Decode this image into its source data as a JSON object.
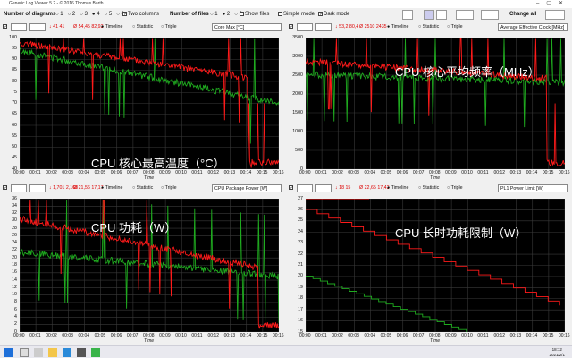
{
  "window": {
    "title": "Generic Log Viewer 5.2 - © 2016 Thomas Barth"
  },
  "toolbar": {
    "num_diagrams_label": "Number of diagrams",
    "diagram_options": [
      "1",
      "2",
      "3",
      "4",
      "5",
      "6"
    ],
    "two_columns": "Two columns",
    "num_files_label": "Number of files",
    "file_options": [
      "1",
      "2",
      "3"
    ],
    "show_files": "Show files",
    "simple_mode": "Simple mode",
    "dark_mode": "Dark mode",
    "change_all": "Change all"
  },
  "panels": [
    {
      "header": {
        "stats": "↓ 41   41",
        "avg": "Ø 54,45  82,92",
        "timeline": "Timeline",
        "statistic": "Statistic",
        "triple": "Triple",
        "sensor": "Core Max [°C]"
      },
      "caption": "CPU 核心最高温度（°C）",
      "yticks": [
        "100",
        "95",
        "90",
        "85",
        "80",
        "75",
        "70",
        "65",
        "60",
        "55",
        "50",
        "45",
        "40"
      ],
      "xaxis_title": "Time"
    },
    {
      "header": {
        "stats": "↓ 53,2  80,4",
        "avg": "Ø 2510  2435",
        "timeline": "Timeline",
        "statistic": "Statistic",
        "triple": "Triple",
        "sensor": "Average Effective Clock [MHz]"
      },
      "caption": "CPU 核心平均频率（MHz）",
      "yticks": [
        "3500",
        "3000",
        "2500",
        "2000",
        "1500",
        "1000",
        "500",
        "0"
      ],
      "xaxis_title": "Time"
    },
    {
      "header": {
        "stats": "↓ 1,701  2,168",
        "avg": "Ø 21,56  17,17",
        "timeline": "Timeline",
        "statistic": "Statistic",
        "triple": "Triple",
        "sensor": "CPU Package Power [W]"
      },
      "caption": "CPU 功耗（W）",
      "yticks": [
        "36",
        "34",
        "32",
        "30",
        "28",
        "26",
        "24",
        "22",
        "20",
        "18",
        "16",
        "14",
        "12",
        "10",
        "8",
        "6",
        "4",
        "2",
        "0"
      ],
      "xaxis_title": "Time"
    },
    {
      "header": {
        "stats": "↓ 18   15",
        "avg": "Ø 22,65  17,42",
        "timeline": "Timeline",
        "statistic": "Statistic",
        "triple": "Triple",
        "sensor": "PL1 Power Limit [W]"
      },
      "caption": "CPU 长时功耗限制（W）",
      "yticks": [
        "27",
        "26",
        "25",
        "24",
        "23",
        "22",
        "21",
        "20",
        "19",
        "18",
        "17",
        "16",
        "15"
      ],
      "xaxis_title": "Time"
    }
  ],
  "xticks": [
    "00:00",
    "00:01",
    "00:02",
    "00:03",
    "00:04",
    "00:05",
    "00:06",
    "00:07",
    "00:08",
    "00:09",
    "00:10",
    "00:11",
    "00:12",
    "00:13",
    "00:14",
    "00:15",
    "00:16"
  ],
  "clock": {
    "time": "18:12",
    "date": "2021/2/1"
  },
  "colors": {
    "red": "#ff1a1a",
    "green": "#1faa1f",
    "grid": "#3a3a3a"
  }
}
